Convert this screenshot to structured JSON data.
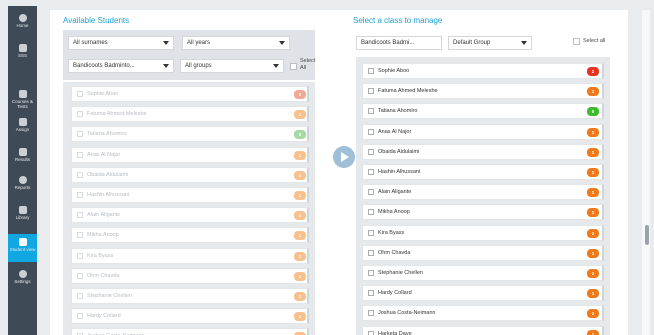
{
  "sidebar": {
    "items": [
      {
        "label": "Home",
        "icon": "home-icon"
      },
      {
        "label": "SSS",
        "icon": "grid-icon"
      },
      {
        "label": "Courses & Tests",
        "icon": "book-icon"
      },
      {
        "label": "Assign",
        "icon": "assign-icon"
      },
      {
        "label": "Results",
        "icon": "results-icon"
      },
      {
        "label": "Reports",
        "icon": "reports-icon"
      },
      {
        "label": "Library",
        "icon": "library-icon"
      },
      {
        "label": "Student view",
        "icon": "student-view-icon"
      },
      {
        "label": "Settings",
        "icon": "gear-icon"
      }
    ]
  },
  "left": {
    "title": "Available Students",
    "filters": {
      "surnames": "All surnames",
      "years": "All years",
      "class": "Bandicoots Badminto...",
      "groups": "All groups",
      "select_all": "Select All"
    },
    "students": [
      {
        "name": "Sophie Aboo",
        "badge": "2",
        "color": "#e8542c"
      },
      {
        "name": "Fatuma Ahmed Meleshe",
        "badge": "1",
        "color": "#f0821e"
      },
      {
        "name": "Tatiana Ahomiro",
        "badge": "0",
        "color": "#4cb648"
      },
      {
        "name": "Anas Al Najar",
        "badge": "1",
        "color": "#f0821e"
      },
      {
        "name": "Obaida Aldulaimi",
        "badge": "1",
        "color": "#f0821e"
      },
      {
        "name": "Hashin Alhussani",
        "badge": "1",
        "color": "#f0821e"
      },
      {
        "name": "Alain Aligante",
        "badge": "1",
        "color": "#f0821e"
      },
      {
        "name": "Mikha Anoop",
        "badge": "1",
        "color": "#f0821e"
      },
      {
        "name": "Kira Byass",
        "badge": "1",
        "color": "#f0821e"
      },
      {
        "name": "Ohm Chavda",
        "badge": "1",
        "color": "#f0821e"
      },
      {
        "name": "Stephanie Chellen",
        "badge": "1",
        "color": "#f0821e"
      },
      {
        "name": "Hardy Collard",
        "badge": "1",
        "color": "#f0821e"
      },
      {
        "name": "Joshua Costa-Neimann",
        "badge": "1",
        "color": "#f0821e"
      }
    ]
  },
  "right": {
    "title": "Select a class to manage",
    "filters": {
      "class": "Bandicoots Badmi...",
      "group": "Default Group",
      "select_all": "Select all"
    },
    "students": [
      {
        "name": "Sophie Aboo",
        "badge": "2",
        "color": "#e8321f"
      },
      {
        "name": "Fatuma Ahmed Meleshe",
        "badge": "1",
        "color": "#f07a1a"
      },
      {
        "name": "Tatiana Ahomiro",
        "badge": "0",
        "color": "#3dbb2f"
      },
      {
        "name": "Anas Al Najor",
        "badge": "1",
        "color": "#f07a1a"
      },
      {
        "name": "Obaida Aldulaimi",
        "badge": "1",
        "color": "#f07a1a"
      },
      {
        "name": "Hashin Alhussani",
        "badge": "1",
        "color": "#f07a1a"
      },
      {
        "name": "Alain Aligante",
        "badge": "1",
        "color": "#f07a1a"
      },
      {
        "name": "Mikha Anoop",
        "badge": "1",
        "color": "#f07a1a"
      },
      {
        "name": "Kira Byass",
        "badge": "1",
        "color": "#f07a1a"
      },
      {
        "name": "Ohm Chavda",
        "badge": "1",
        "color": "#f07a1a"
      },
      {
        "name": "Stephanie Chellen",
        "badge": "1",
        "color": "#f07a1a"
      },
      {
        "name": "Hardy Collard",
        "badge": "1",
        "color": "#f07a1a"
      },
      {
        "name": "Joshua Costa-Neimann",
        "badge": "1",
        "color": "#f07a1a"
      },
      {
        "name": "Harketa Dave",
        "badge": "1",
        "color": "#f07a1a"
      }
    ]
  },
  "transfer_button_icon": "play-icon"
}
